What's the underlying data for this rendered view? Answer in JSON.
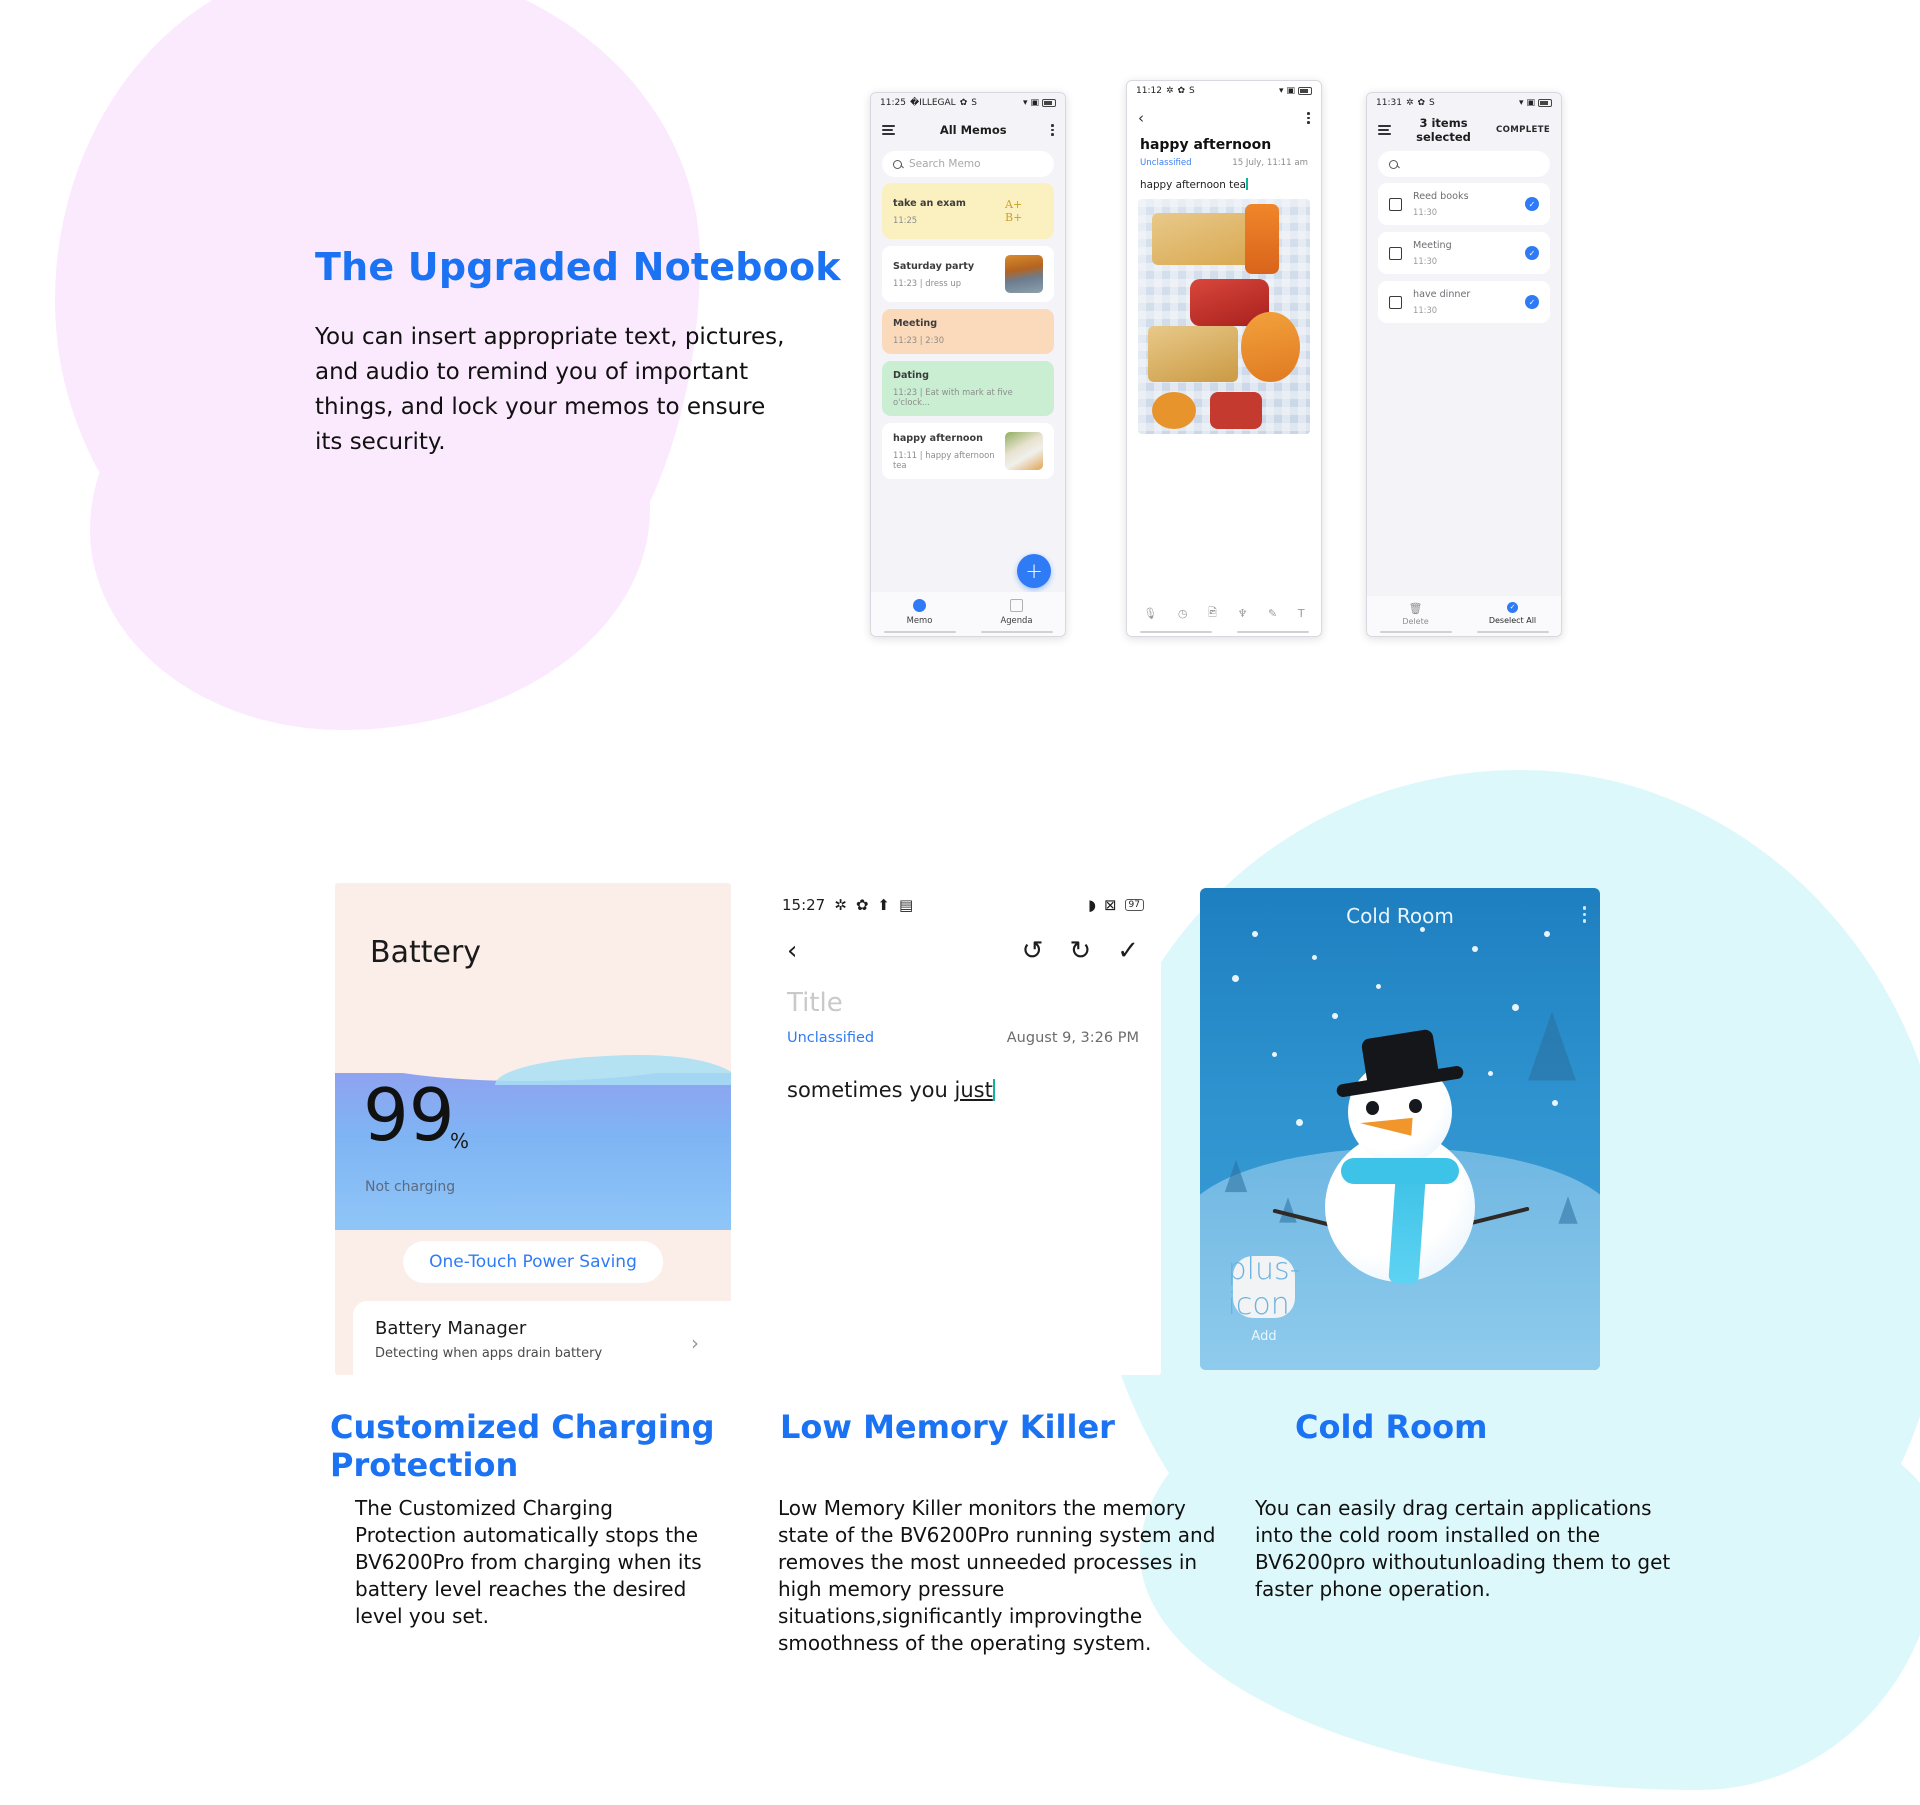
{
  "colors": {
    "accent_blue": "#1b72f2",
    "link_blue": "#2f7bf6",
    "blob_pink": "#fbeafd",
    "blob_cyan": "#ddf8fb",
    "battery_card_bg": "#fbeee9",
    "cold_room_blue": "#2e93cf"
  },
  "section_notebook": {
    "title": "The Upgraded Notebook",
    "body": "You can insert appropriate text, pictures, and audio to remind you of important things, and lock your memos to ensure its security."
  },
  "phone_memo_list": {
    "status": {
      "time": "11:25",
      "icons": [
        "bluetooth-icon",
        "gear-icon",
        "s-icon"
      ],
      "right_icons": [
        "wifi-icon",
        "sim-icon",
        "battery-icon"
      ]
    },
    "appbar": {
      "menu_icon": "hamburger-icon",
      "title": "All Memos",
      "overflow_icon": "kebab-icon"
    },
    "search": {
      "placeholder": "Search Memo",
      "icon": "search-icon"
    },
    "memos": [
      {
        "title": "take an exam",
        "subtitle": "11:25",
        "bg": "#fbf0c0",
        "thumb": "handwriting",
        "thumb_text": "A+ B+"
      },
      {
        "title": "Saturday party",
        "subtitle": "11:23 | dress up",
        "bg": "#ffffff",
        "thumb": "photo-autumn"
      },
      {
        "title": "Meeting",
        "subtitle": "11:23 | 2:30",
        "bg": "#fbd9bb",
        "thumb": "none"
      },
      {
        "title": "Dating",
        "subtitle": "11:23 | Eat with mark at five o'clock...",
        "bg": "#c9eed2",
        "thumb": "none"
      },
      {
        "title": "happy afternoon",
        "subtitle": "11:11 | happy afternoon tea",
        "bg": "#ffffff",
        "thumb": "photo-food"
      }
    ],
    "fab_label": "+",
    "tabs": [
      {
        "label": "Memo",
        "icon": "memo-icon",
        "active": true
      },
      {
        "label": "Agenda",
        "icon": "agenda-icon",
        "active": false
      }
    ]
  },
  "phone_note_view": {
    "status": {
      "time": "11:12"
    },
    "back_icon": "chevron-left-icon",
    "overflow_icon": "kebab-icon",
    "title": "happy afternoon",
    "classification": "Unclassified",
    "date": "15 July, 11:11 am",
    "body": "happy afternoon tea",
    "image_caption": "picnic-photo",
    "toolbar": [
      {
        "icon": "mic-icon"
      },
      {
        "icon": "clock-icon"
      },
      {
        "icon": "image-icon"
      },
      {
        "icon": "tag-icon"
      },
      {
        "icon": "pen-icon"
      },
      {
        "icon": "text-icon"
      }
    ]
  },
  "phone_selection": {
    "status": {
      "time": "11:31"
    },
    "appbar": {
      "menu_icon": "hamburger-icon",
      "title": "3 items selected",
      "action": "COMPLETE"
    },
    "search": {
      "placeholder": "",
      "icon": "search-icon"
    },
    "items": [
      {
        "title": "Reed books",
        "subtitle": "11:30",
        "selected": true
      },
      {
        "title": "Meeting",
        "subtitle": "11:30",
        "selected": true
      },
      {
        "title": "have dinner",
        "subtitle": "11:30",
        "selected": true
      }
    ],
    "bottom_actions": [
      {
        "label": "Delete",
        "icon": "trash-icon"
      },
      {
        "label": "Deselect All",
        "icon": "deselect-icon"
      }
    ]
  },
  "battery_card": {
    "heading": "Battery",
    "level": "99",
    "percent_symbol": "%",
    "status": "Not charging",
    "power_saving_button": "One-Touch Power Saving",
    "manager_title": "Battery Manager",
    "manager_subtitle": "Detecting when apps drain battery",
    "chevron_icon": "chevron-right-icon"
  },
  "note_editor_card": {
    "status": {
      "time": "15:27",
      "battery_level": "97"
    },
    "back_icon": "chevron-left-icon",
    "undo_icon": "undo-icon",
    "redo_icon": "redo-icon",
    "confirm_icon": "check-icon",
    "title_placeholder": "Title",
    "classification": "Unclassified",
    "date": "August 9, 3:26 PM",
    "body_plain": "sometimes you ",
    "body_underlined": "just"
  },
  "cold_room_card": {
    "title": "Cold Room",
    "overflow_icon": "kebab-icon",
    "add_tile_label": "Add",
    "add_tile_icon": "plus-icon",
    "illustration": "snowman-winter-scene"
  },
  "features": [
    {
      "heading": "Customized Charging Protection",
      "body": "The Customized Charging Protection automatically stops the BV6200Pro from charging when its battery level reaches the desired level you set."
    },
    {
      "heading": "Low Memory Killer",
      "body": "Low Memory Killer monitors the memory state of the BV6200Pro running system and removes the most unneeded processes in high memory pressure situations,significantly improvingthe smoothness of the operating system."
    },
    {
      "heading": "Cold Room",
      "body": "You can easily drag certain applications into the cold room installed on the BV6200pro withoutunloading them to get faster phone operation."
    }
  ]
}
